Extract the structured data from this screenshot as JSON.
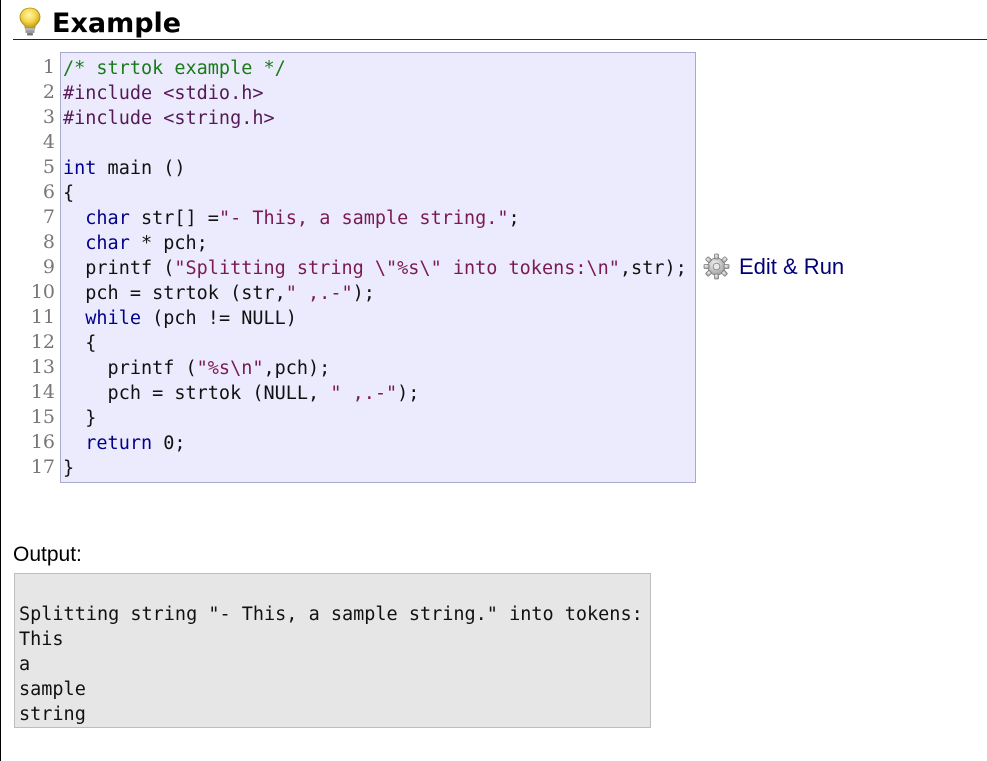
{
  "header": {
    "title": "Example",
    "icon": "lightbulb-icon"
  },
  "code": {
    "line_numbers": [
      "1",
      "2",
      "3",
      "4",
      "5",
      "6",
      "7",
      "8",
      "9",
      "10",
      "11",
      "12",
      "13",
      "14",
      "15",
      "16",
      "17"
    ],
    "lines": [
      [
        {
          "t": "/* strtok example */",
          "c": "cm"
        }
      ],
      [
        {
          "t": "#include <stdio.h>",
          "c": "pp"
        }
      ],
      [
        {
          "t": "#include <string.h>",
          "c": "pp"
        }
      ],
      [
        {
          "t": "",
          "c": ""
        }
      ],
      [
        {
          "t": "int",
          "c": "kw"
        },
        {
          "t": " main ()",
          "c": ""
        }
      ],
      [
        {
          "t": "{",
          "c": ""
        }
      ],
      [
        {
          "t": "  ",
          "c": ""
        },
        {
          "t": "char",
          "c": "kw"
        },
        {
          "t": " str[] =",
          "c": ""
        },
        {
          "t": "\"- This, a sample string.\"",
          "c": "st"
        },
        {
          "t": ";",
          "c": ""
        }
      ],
      [
        {
          "t": "  ",
          "c": ""
        },
        {
          "t": "char",
          "c": "kw"
        },
        {
          "t": " * pch;",
          "c": ""
        }
      ],
      [
        {
          "t": "  printf (",
          "c": ""
        },
        {
          "t": "\"Splitting string \\\"%s\\\" into tokens:\\n\"",
          "c": "st"
        },
        {
          "t": ",str);",
          "c": ""
        }
      ],
      [
        {
          "t": "  pch = strtok (str,",
          "c": ""
        },
        {
          "t": "\" ,.-\"",
          "c": "st"
        },
        {
          "t": ");",
          "c": ""
        }
      ],
      [
        {
          "t": "  ",
          "c": ""
        },
        {
          "t": "while",
          "c": "kw"
        },
        {
          "t": " (pch != NULL)",
          "c": ""
        }
      ],
      [
        {
          "t": "  {",
          "c": ""
        }
      ],
      [
        {
          "t": "    printf (",
          "c": ""
        },
        {
          "t": "\"%s\\n\"",
          "c": "st"
        },
        {
          "t": ",pch);",
          "c": ""
        }
      ],
      [
        {
          "t": "    pch = strtok (NULL, ",
          "c": ""
        },
        {
          "t": "\" ,.-\"",
          "c": "st"
        },
        {
          "t": ");",
          "c": ""
        }
      ],
      [
        {
          "t": "  }",
          "c": ""
        }
      ],
      [
        {
          "t": "  ",
          "c": ""
        },
        {
          "t": "return",
          "c": "kw"
        },
        {
          "t": " 0;",
          "c": ""
        }
      ],
      [
        {
          "t": "}",
          "c": ""
        }
      ]
    ]
  },
  "edit_run": {
    "label": "Edit & Run",
    "icon": "gear-icon"
  },
  "output": {
    "label": "Output:",
    "lines": [
      "Splitting string \"- This, a sample string.\" into tokens:",
      "This",
      "a",
      "sample",
      "string"
    ]
  }
}
